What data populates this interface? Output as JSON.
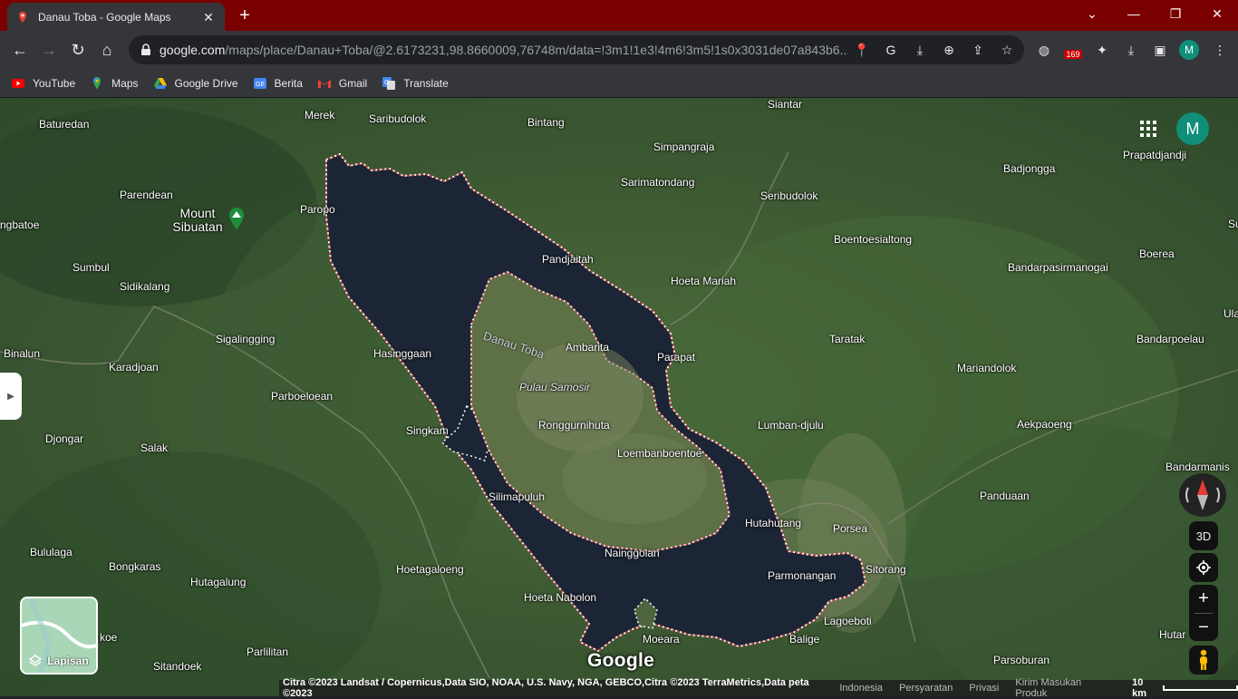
{
  "browser": {
    "tab_title": "Danau Toba - Google Maps",
    "close_tab": "✕",
    "new_tab": "+",
    "url_host": "google.com",
    "url_path": "/maps/place/Danau+Toba/@2.6173231,98.8660009,76748m/data=!3m1!1e3!4m6!3m5!1s0x3031de07a843b6...",
    "extension_badge": "169"
  },
  "bookmarks": [
    {
      "label": "YouTube"
    },
    {
      "label": "Maps"
    },
    {
      "label": "Google Drive"
    },
    {
      "label": "Berita"
    },
    {
      "label": "Gmail"
    },
    {
      "label": "Translate"
    }
  ],
  "profile_initial": "M",
  "map": {
    "lake_name": "Danau Toba",
    "mountain_name": "Mount Sibuatan",
    "places": {
      "baturedan": "Baturedan",
      "merek": "Merek",
      "saribudolok": "Saribudolok",
      "bintang": "Bintang",
      "siantar": "Siantar",
      "simpangraja": "Simpangraja",
      "sarimatondang": "Sarimatondang",
      "seribudolok": "Seribudolok",
      "badjongga": "Badjongga",
      "prapatdjandji": "Prapatdjandji",
      "parendean": "Parendean",
      "paropo": "Paropo",
      "ngbatoe": "ngbatoe",
      "boentoesialtong": "Boentoesialtong",
      "boerea": "Boerea",
      "pandjaitah": "Pandjaitah",
      "sumbul": "Sumbul",
      "bandarpasirmanogai": "Bandarpasirmanogai",
      "hoeta_mariah": "Hoeta Mariah",
      "sidikalang": "Sidikalang",
      "sigalingging": "Sigalingging",
      "taratak": "Taratak",
      "bandarpoelau": "Bandarpoelau",
      "ambarita": "Ambarita",
      "binalun": "Binalun",
      "hasinggaan": "Hasinggaan",
      "parapat": "Parapat",
      "karadjoan": "Karadjoan",
      "mariandolok": "Mariandolok",
      "pulau_samosir": "Pulau Samosir",
      "parboeloean": "Parboeloean",
      "ronggurnihuta": "Ronggurnihuta",
      "lumban_djulu": "Lumban-djulu",
      "aekpaoeng": "Aekpaoeng",
      "singkam": "Singkam",
      "djongar": "Djongar",
      "loembanboentoe": "Loembanboentoe",
      "salak": "Salak",
      "bandarmanis": "Bandarmanis",
      "silimapuluh": "Silimapuluh",
      "panduaan": "Panduaan",
      "hutahutang": "Hutahutang",
      "porsea": "Porsea",
      "bululaga": "Bululaga",
      "nainggolan": "Nainggolan",
      "bongkaras": "Bongkaras",
      "hoetagaloeng": "Hoetagaloeng",
      "sitorang": "Sitorang",
      "parmonangan": "Parmonangan",
      "hutagalung": "Hutagalung",
      "hoeta_nabolon": "Hoeta Nabolon",
      "lagoeboti": "Lagoeboti",
      "koe": "koe",
      "moeara": "Moeara",
      "balige": "Balige",
      "hutar": "Hutar",
      "parlilitan": "Parlilitan",
      "sitandoek": "Sitandoek",
      "parsoburan": "Parsoburan",
      "su": "Su",
      "ula": "Ula"
    }
  },
  "controls": {
    "layers_label": "Lapisan",
    "btn_3d": "3D",
    "zoom_in": "+",
    "zoom_out": "−"
  },
  "footer": {
    "logo": "Google",
    "credit": "Citra ©2023 Landsat / Copernicus,Data SIO, NOAA, U.S. Navy, NGA, GEBCO,Citra ©2023 TerraMetrics,Data peta ©2023",
    "country": "Indonesia",
    "terms": "Persyaratan",
    "privacy": "Privasi",
    "feedback": "Kirim Masukan Produk",
    "scale": "10 km"
  }
}
